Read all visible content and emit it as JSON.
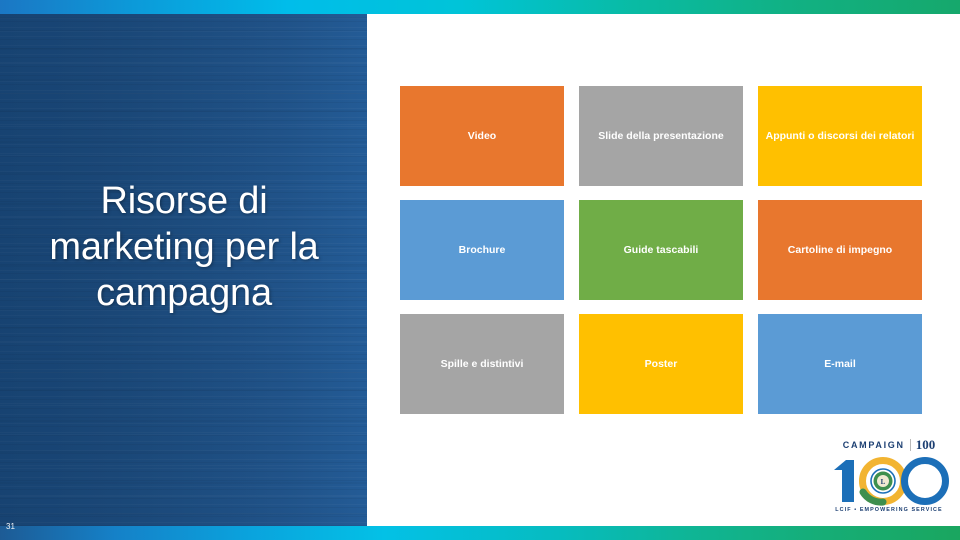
{
  "slide": {
    "title": "Risorse di marketing per la campagna",
    "page_number": "31"
  },
  "colors": {
    "orange": "#E8772E",
    "gray": "#A5A5A5",
    "gold": "#FFC000",
    "blue": "#5B9BD5",
    "green": "#70AD47",
    "panel_white": "#FFFFFF",
    "title_text": "#FFFFFF",
    "bg_navy": "#1F5386",
    "bg_cyan": "#00C9E8",
    "strip_green": "#16A86C",
    "logo_navy": "#1C3F72",
    "logo_gold": "#F2B431"
  },
  "tiles": [
    {
      "label": "Video",
      "color": "#E8772E"
    },
    {
      "label": "Slide della presentazione",
      "color": "#A5A5A5"
    },
    {
      "label": "Appunti o discorsi dei relatori",
      "color": "#FFC000"
    },
    {
      "label": "Brochure",
      "color": "#5B9BD5"
    },
    {
      "label": "Guide tascabili",
      "color": "#70AD47"
    },
    {
      "label": "Cartoline di impegno",
      "color": "#E8772E"
    },
    {
      "label": "Spille e distintivi",
      "color": "#A5A5A5"
    },
    {
      "label": "Poster",
      "color": "#FFC000"
    },
    {
      "label": "E-mail",
      "color": "#5B9BD5"
    }
  ],
  "logo": {
    "campaign_text": "CAMPAIGN",
    "hundred_small": "100",
    "tagline": "LCIF • EMPOWERING SERVICE"
  }
}
